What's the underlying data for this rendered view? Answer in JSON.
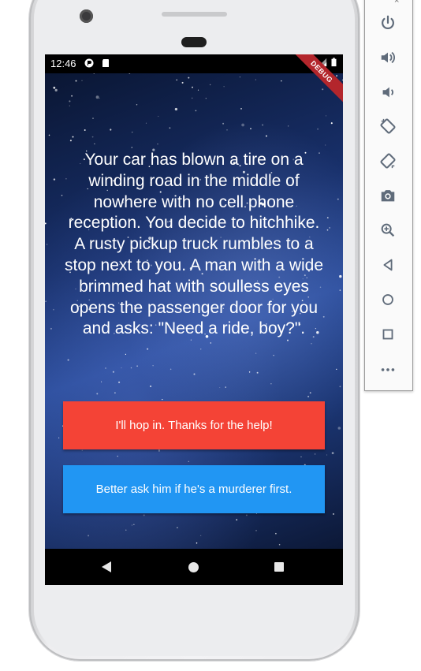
{
  "status_bar": {
    "time": "12:46",
    "debug_banner": "DEBUG"
  },
  "story": {
    "text": "Your car has blown a tire on a winding road in the middle of nowhere with no cell phone reception. You decide to hitchhike. A rusty pickup truck rumbles to a stop next to you. A man with a wide brimmed hat with soulless eyes opens the passenger door for you and asks: \"Need a ride, boy?\"."
  },
  "choices": {
    "choice1": "I'll hop in. Thanks for the help!",
    "choice2": "Better ask him if he's a murderer first."
  },
  "colors": {
    "choice1_bg": "#f44336",
    "choice2_bg": "#2196f3",
    "debug_ribbon": "#b3262c",
    "toolbar_icon": "#5f6b7a"
  },
  "nav_bar": {
    "icons": [
      "back-icon",
      "home-icon",
      "recents-icon"
    ]
  },
  "emulator_toolbar": {
    "icons": [
      "close-icon",
      "power-icon",
      "volume-up-icon",
      "volume-down-icon",
      "rotate-left-icon",
      "rotate-right-icon",
      "camera-icon",
      "zoom-icon",
      "back-icon",
      "home-icon",
      "overview-icon",
      "more-icon"
    ]
  }
}
